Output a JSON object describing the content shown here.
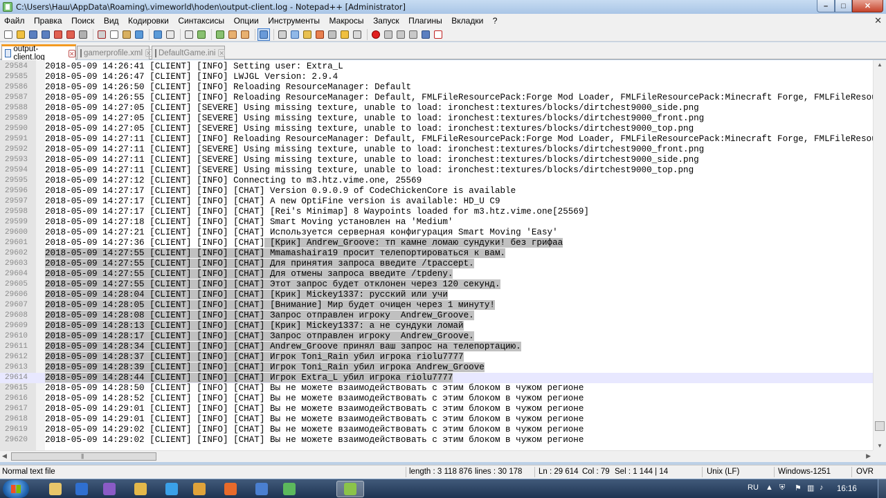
{
  "window": {
    "title": "C:\\Users\\Наш\\AppData\\Roaming\\.vimeworld\\hoden\\output-client.log - Notepad++ [Administrator]"
  },
  "menu": [
    "Файл",
    "Правка",
    "Поиск",
    "Вид",
    "Кодировки",
    "Синтаксисы",
    "Опции",
    "Инструменты",
    "Макросы",
    "Запуск",
    "Плагины",
    "Вкладки",
    "?"
  ],
  "menu_close": "✕",
  "tabs": [
    {
      "label": "output-client.log",
      "active": true
    },
    {
      "label": "gamerprofile.xml",
      "active": false
    },
    {
      "label": "DefaultGame.ini",
      "active": false
    }
  ],
  "toolbar_icons": [
    "new-file-icon",
    "open-file-icon",
    "save-icon",
    "save-all-icon",
    "close-icon",
    "close-all-icon",
    "print-icon",
    "cut-icon",
    "copy-icon",
    "paste-icon",
    "undo-icon",
    "redo-icon",
    "find-icon",
    "replace-icon",
    "zoom-in-icon",
    "zoom-out-icon",
    "sync-v-icon",
    "sync-h-icon",
    "word-wrap-icon",
    "all-chars-icon",
    "indent-guide-icon",
    "udl-icon",
    "doc-map-icon",
    "function-list-icon",
    "folder-workspace-icon",
    "monitor-icon",
    "record-macro-icon",
    "stop-macro-icon",
    "play-macro-icon",
    "run-macro-icon",
    "save-macro-icon",
    "spellcheck-icon"
  ],
  "editor": {
    "lines": [
      {
        "n": "29584",
        "text": "2018-05-09 14:26:41 [CLIENT] [INFO] Setting user: Extra_L",
        "sel": "none"
      },
      {
        "n": "29585",
        "text": "2018-05-09 14:26:47 [CLIENT] [INFO] LWJGL Version: 2.9.4",
        "sel": "none"
      },
      {
        "n": "29586",
        "text": "2018-05-09 14:26:50 [CLIENT] [INFO] Reloading ResourceManager: Default",
        "sel": "none"
      },
      {
        "n": "29587",
        "text": "2018-05-09 14:26:55 [CLIENT] [INFO] Reloading ResourceManager: Default, FMLFileResourcePack:Forge Mod Loader, FMLFileResourcePack:Minecraft Forge, FMLFileResou:",
        "sel": "none"
      },
      {
        "n": "29588",
        "text": "2018-05-09 14:27:05 [CLIENT] [SEVERE] Using missing texture, unable to load: ironchest:textures/blocks/dirtchest9000_side.png",
        "sel": "none"
      },
      {
        "n": "29589",
        "text": "2018-05-09 14:27:05 [CLIENT] [SEVERE] Using missing texture, unable to load: ironchest:textures/blocks/dirtchest9000_front.png",
        "sel": "none"
      },
      {
        "n": "29590",
        "text": "2018-05-09 14:27:05 [CLIENT] [SEVERE] Using missing texture, unable to load: ironchest:textures/blocks/dirtchest9000_top.png",
        "sel": "none"
      },
      {
        "n": "29591",
        "text": "2018-05-09 14:27:11 [CLIENT] [INFO] Reloading ResourceManager: Default, FMLFileResourcePack:Forge Mod Loader, FMLFileResourcePack:Minecraft Forge, FMLFileResou:",
        "sel": "none"
      },
      {
        "n": "29592",
        "text": "2018-05-09 14:27:11 [CLIENT] [SEVERE] Using missing texture, unable to load: ironchest:textures/blocks/dirtchest9000_front.png",
        "sel": "none"
      },
      {
        "n": "29593",
        "text": "2018-05-09 14:27:11 [CLIENT] [SEVERE] Using missing texture, unable to load: ironchest:textures/blocks/dirtchest9000_side.png",
        "sel": "none"
      },
      {
        "n": "29594",
        "text": "2018-05-09 14:27:11 [CLIENT] [SEVERE] Using missing texture, unable to load: ironchest:textures/blocks/dirtchest9000_top.png",
        "sel": "none"
      },
      {
        "n": "29595",
        "text": "2018-05-09 14:27:12 [CLIENT] [INFO] Connecting to m3.htz.vime.one, 25569",
        "sel": "none"
      },
      {
        "n": "29596",
        "text": "2018-05-09 14:27:17 [CLIENT] [INFO] [CHAT] Version 0.9.0.9 of CodeChickenCore is available",
        "sel": "none"
      },
      {
        "n": "29597",
        "text": "2018-05-09 14:27:17 [CLIENT] [INFO] [CHAT] A new OptiFine version is available: HD_U C9",
        "sel": "none"
      },
      {
        "n": "29598",
        "text": "2018-05-09 14:27:17 [CLIENT] [INFO] [CHAT] [Rei's Minimap] 8 Waypoints loaded for m3.htz.vime.one[25569]",
        "sel": "none"
      },
      {
        "n": "29599",
        "text": "2018-05-09 14:27:18 [CLIENT] [INFO] [CHAT] Smart Moving установлен на 'Medium'",
        "sel": "none"
      },
      {
        "n": "29600",
        "text": "2018-05-09 14:27:21 [CLIENT] [INFO] [CHAT] Используется серверная конфигурация Smart Moving 'Easy'",
        "sel": "none"
      },
      {
        "n": "29601",
        "text": "2018-05-09 14:27:36 [CLIENT] [INFO] [CHAT] [Крик] Andrew_Groove: тп камне ломаю сундуки! без грифаа",
        "sel": "partial",
        "selStart": 42
      },
      {
        "n": "29602",
        "text": "2018-05-09 14:27:55 [CLIENT] [INFO] [CHAT] Mmamashaira19 просит телепортироваться к вам.",
        "sel": "full"
      },
      {
        "n": "29603",
        "text": "2018-05-09 14:27:55 [CLIENT] [INFO] [CHAT] Для принятия запроса введите /tpaccept.",
        "sel": "full"
      },
      {
        "n": "29604",
        "text": "2018-05-09 14:27:55 [CLIENT] [INFO] [CHAT] Для отмены запроса введите /tpdeny.",
        "sel": "full"
      },
      {
        "n": "29605",
        "text": "2018-05-09 14:27:55 [CLIENT] [INFO] [CHAT] Этот запрос будет отклонен через 120 секунд.",
        "sel": "full"
      },
      {
        "n": "29606",
        "text": "2018-05-09 14:28:04 [CLIENT] [INFO] [CHAT] [Крик] Mickey1337: русский или учи",
        "sel": "full"
      },
      {
        "n": "29607",
        "text": "2018-05-09 14:28:05 [CLIENT] [INFO] [CHAT] [Внимание] Мир будет очищен через 1 минуту!",
        "sel": "full"
      },
      {
        "n": "29608",
        "text": "2018-05-09 14:28:08 [CLIENT] [INFO] [CHAT] Запрос отправлен игроку  Andrew_Groove.",
        "sel": "full"
      },
      {
        "n": "29609",
        "text": "2018-05-09 14:28:13 [CLIENT] [INFO] [CHAT] [Крик] Mickey1337: а не сундуки ломай",
        "sel": "full"
      },
      {
        "n": "29610",
        "text": "2018-05-09 14:28:17 [CLIENT] [INFO] [CHAT] Запрос отправлен игроку  Andrew_Groove.",
        "sel": "full"
      },
      {
        "n": "29611",
        "text": "2018-05-09 14:28:34 [CLIENT] [INFO] [CHAT] Andrew_Groove принял ваш запрос на телепортацию.",
        "sel": "full"
      },
      {
        "n": "29612",
        "text": "2018-05-09 14:28:37 [CLIENT] [INFO] [CHAT] Игрок Toni_Rain убил игрока riolu7777",
        "sel": "full"
      },
      {
        "n": "29613",
        "text": "2018-05-09 14:28:39 [CLIENT] [INFO] [CHAT] Игрок Toni_Rain убил игрока Andrew_Groove",
        "sel": "full"
      },
      {
        "n": "29614",
        "text": "2018-05-09 14:28:44 [CLIENT] [INFO] [CHAT] Игрок Extra_L убил игрока riolu7777",
        "sel": "full",
        "current": true
      },
      {
        "n": "29615",
        "text": "2018-05-09 14:28:50 [CLIENT] [INFO] [CHAT] Вы не можете взаимодействовать с этим блоком в чужом регионе",
        "sel": "none"
      },
      {
        "n": "29616",
        "text": "2018-05-09 14:28:52 [CLIENT] [INFO] [CHAT] Вы не можете взаимодействовать с этим блоком в чужом регионе",
        "sel": "none"
      },
      {
        "n": "29617",
        "text": "2018-05-09 14:29:01 [CLIENT] [INFO] [CHAT] Вы не можете взаимодействовать с этим блоком в чужом регионе",
        "sel": "none"
      },
      {
        "n": "29618",
        "text": "2018-05-09 14:29:01 [CLIENT] [INFO] [CHAT] Вы не можете взаимодействовать с этим блоком в чужом регионе",
        "sel": "none"
      },
      {
        "n": "29619",
        "text": "2018-05-09 14:29:02 [CLIENT] [INFO] [CHAT] Вы не можете взаимодействовать с этим блоком в чужом регионе",
        "sel": "none"
      },
      {
        "n": "29620",
        "text": "2018-05-09 14:29:02 [CLIENT] [INFO] [CHAT] Вы не можете взаимодействовать с этим блоком в чужом регионе",
        "sel": "none"
      }
    ]
  },
  "status": {
    "file_type": "Normal text file",
    "length": "length : 3 118 876",
    "lines": "lines : 30 178",
    "ln": "Ln : 29 614",
    "col": "Col : 79",
    "sel": "Sel : 1 144 | 14",
    "eol": "Unix (LF)",
    "encoding": "Windows-1251",
    "mode": "OVR"
  },
  "taskbar": {
    "lang": "RU",
    "clock": "16:16",
    "apps": [
      {
        "name": "explorer-icon",
        "color": "#e8c66a"
      },
      {
        "name": "app-icon",
        "color": "#2f6fd0"
      },
      {
        "name": "visual-studio-icon",
        "color": "#8a5bc6"
      },
      {
        "name": "folder-icon",
        "color": "#e4b84a"
      },
      {
        "name": "ie-icon",
        "color": "#3aa0e8"
      },
      {
        "name": "chrome-icon",
        "color": "#e0a33a"
      },
      {
        "name": "firefox-icon",
        "color": "#e86a2a"
      },
      {
        "name": "save-app-icon",
        "color": "#4a7fd0"
      },
      {
        "name": "utorrent-icon",
        "color": "#5cb85c"
      },
      {
        "name": "notepadpp-icon",
        "color": "#8bc34a"
      }
    ]
  }
}
